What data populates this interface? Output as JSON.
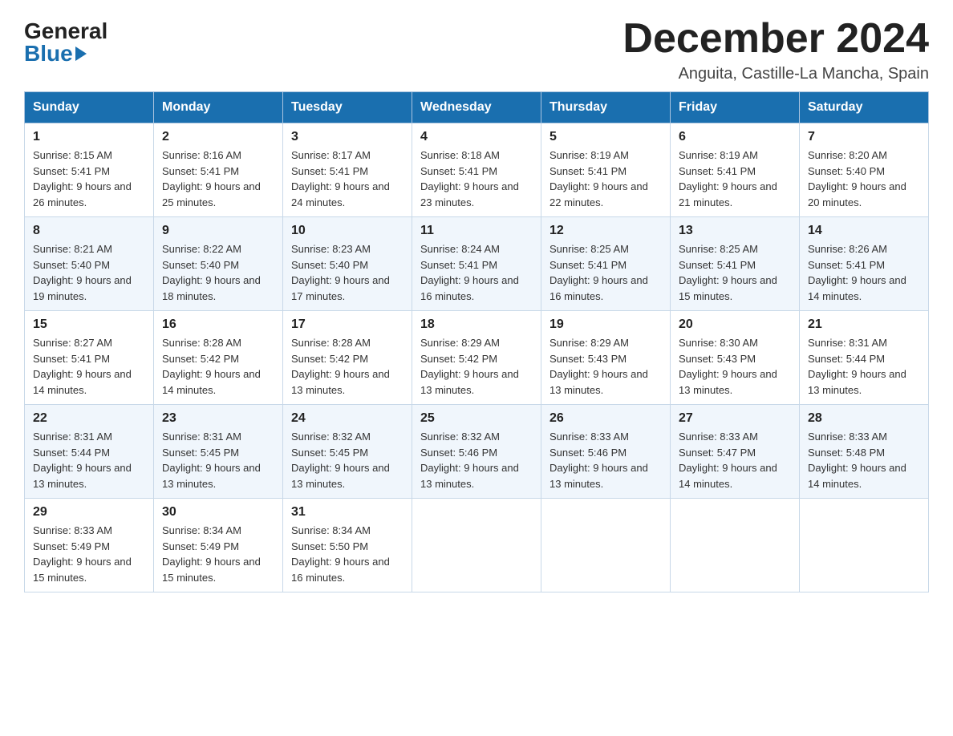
{
  "header": {
    "logo_general": "General",
    "logo_blue": "Blue",
    "title": "December 2024",
    "location": "Anguita, Castille-La Mancha, Spain"
  },
  "weekdays": [
    "Sunday",
    "Monday",
    "Tuesday",
    "Wednesday",
    "Thursday",
    "Friday",
    "Saturday"
  ],
  "weeks": [
    [
      {
        "day": "1",
        "sunrise": "8:15 AM",
        "sunset": "5:41 PM",
        "daylight": "9 hours and 26 minutes."
      },
      {
        "day": "2",
        "sunrise": "8:16 AM",
        "sunset": "5:41 PM",
        "daylight": "9 hours and 25 minutes."
      },
      {
        "day": "3",
        "sunrise": "8:17 AM",
        "sunset": "5:41 PM",
        "daylight": "9 hours and 24 minutes."
      },
      {
        "day": "4",
        "sunrise": "8:18 AM",
        "sunset": "5:41 PM",
        "daylight": "9 hours and 23 minutes."
      },
      {
        "day": "5",
        "sunrise": "8:19 AM",
        "sunset": "5:41 PM",
        "daylight": "9 hours and 22 minutes."
      },
      {
        "day": "6",
        "sunrise": "8:19 AM",
        "sunset": "5:41 PM",
        "daylight": "9 hours and 21 minutes."
      },
      {
        "day": "7",
        "sunrise": "8:20 AM",
        "sunset": "5:40 PM",
        "daylight": "9 hours and 20 minutes."
      }
    ],
    [
      {
        "day": "8",
        "sunrise": "8:21 AM",
        "sunset": "5:40 PM",
        "daylight": "9 hours and 19 minutes."
      },
      {
        "day": "9",
        "sunrise": "8:22 AM",
        "sunset": "5:40 PM",
        "daylight": "9 hours and 18 minutes."
      },
      {
        "day": "10",
        "sunrise": "8:23 AM",
        "sunset": "5:40 PM",
        "daylight": "9 hours and 17 minutes."
      },
      {
        "day": "11",
        "sunrise": "8:24 AM",
        "sunset": "5:41 PM",
        "daylight": "9 hours and 16 minutes."
      },
      {
        "day": "12",
        "sunrise": "8:25 AM",
        "sunset": "5:41 PM",
        "daylight": "9 hours and 16 minutes."
      },
      {
        "day": "13",
        "sunrise": "8:25 AM",
        "sunset": "5:41 PM",
        "daylight": "9 hours and 15 minutes."
      },
      {
        "day": "14",
        "sunrise": "8:26 AM",
        "sunset": "5:41 PM",
        "daylight": "9 hours and 14 minutes."
      }
    ],
    [
      {
        "day": "15",
        "sunrise": "8:27 AM",
        "sunset": "5:41 PM",
        "daylight": "9 hours and 14 minutes."
      },
      {
        "day": "16",
        "sunrise": "8:28 AM",
        "sunset": "5:42 PM",
        "daylight": "9 hours and 14 minutes."
      },
      {
        "day": "17",
        "sunrise": "8:28 AM",
        "sunset": "5:42 PM",
        "daylight": "9 hours and 13 minutes."
      },
      {
        "day": "18",
        "sunrise": "8:29 AM",
        "sunset": "5:42 PM",
        "daylight": "9 hours and 13 minutes."
      },
      {
        "day": "19",
        "sunrise": "8:29 AM",
        "sunset": "5:43 PM",
        "daylight": "9 hours and 13 minutes."
      },
      {
        "day": "20",
        "sunrise": "8:30 AM",
        "sunset": "5:43 PM",
        "daylight": "9 hours and 13 minutes."
      },
      {
        "day": "21",
        "sunrise": "8:31 AM",
        "sunset": "5:44 PM",
        "daylight": "9 hours and 13 minutes."
      }
    ],
    [
      {
        "day": "22",
        "sunrise": "8:31 AM",
        "sunset": "5:44 PM",
        "daylight": "9 hours and 13 minutes."
      },
      {
        "day": "23",
        "sunrise": "8:31 AM",
        "sunset": "5:45 PM",
        "daylight": "9 hours and 13 minutes."
      },
      {
        "day": "24",
        "sunrise": "8:32 AM",
        "sunset": "5:45 PM",
        "daylight": "9 hours and 13 minutes."
      },
      {
        "day": "25",
        "sunrise": "8:32 AM",
        "sunset": "5:46 PM",
        "daylight": "9 hours and 13 minutes."
      },
      {
        "day": "26",
        "sunrise": "8:33 AM",
        "sunset": "5:46 PM",
        "daylight": "9 hours and 13 minutes."
      },
      {
        "day": "27",
        "sunrise": "8:33 AM",
        "sunset": "5:47 PM",
        "daylight": "9 hours and 14 minutes."
      },
      {
        "day": "28",
        "sunrise": "8:33 AM",
        "sunset": "5:48 PM",
        "daylight": "9 hours and 14 minutes."
      }
    ],
    [
      {
        "day": "29",
        "sunrise": "8:33 AM",
        "sunset": "5:49 PM",
        "daylight": "9 hours and 15 minutes."
      },
      {
        "day": "30",
        "sunrise": "8:34 AM",
        "sunset": "5:49 PM",
        "daylight": "9 hours and 15 minutes."
      },
      {
        "day": "31",
        "sunrise": "8:34 AM",
        "sunset": "5:50 PM",
        "daylight": "9 hours and 16 minutes."
      },
      null,
      null,
      null,
      null
    ]
  ]
}
